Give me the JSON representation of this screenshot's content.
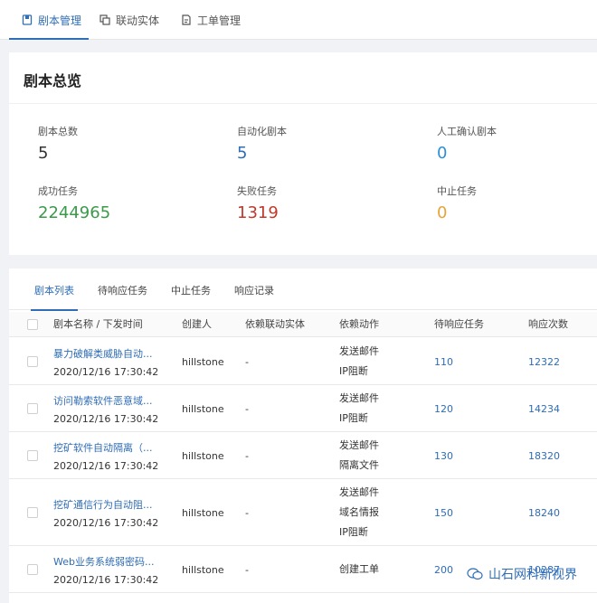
{
  "top_tabs": [
    {
      "label": "剧本管理",
      "icon": "playbook-icon"
    },
    {
      "label": "联动实体",
      "icon": "copy-icon"
    },
    {
      "label": "工单管理",
      "icon": "ticket-icon"
    }
  ],
  "overview": {
    "title": "剧本总览",
    "stats": [
      {
        "label": "剧本总数",
        "value": "5",
        "color": "#333333"
      },
      {
        "label": "自动化剧本",
        "value": "5",
        "color": "#2f6db5"
      },
      {
        "label": "人工确认剧本",
        "value": "0",
        "color": "#2f8fd6"
      },
      {
        "label": "成功任务",
        "value": "2244965",
        "color": "#3a9a4a"
      },
      {
        "label": "失败任务",
        "value": "1319",
        "color": "#c0392b"
      },
      {
        "label": "中止任务",
        "value": "0",
        "color": "#e8a33a"
      }
    ]
  },
  "sub_tabs": [
    "剧本列表",
    "待响应任务",
    "中止任务",
    "响应记录"
  ],
  "table": {
    "headers": [
      "剧本名称 / 下发时间",
      "创建人",
      "依赖联动实体",
      "依赖动作",
      "待响应任务",
      "响应次数"
    ],
    "rows": [
      {
        "name": "暴力破解类威胁自动...",
        "time": "2020/12/16 17:30:42",
        "creator": "hillstone",
        "entity": "-",
        "actions": [
          "发送邮件",
          "IP阻断"
        ],
        "pending": "110",
        "count": "12322"
      },
      {
        "name": "访问勒索软件恶意域...",
        "time": "2020/12/16 17:30:42",
        "creator": "hillstone",
        "entity": "-",
        "actions": [
          "发送邮件",
          "IP阻断"
        ],
        "pending": "120",
        "count": "14234"
      },
      {
        "name": "挖矿软件自动隔离（...",
        "time": "2020/12/16 17:30:42",
        "creator": "hillstone",
        "entity": "-",
        "actions": [
          "发送邮件",
          "隔离文件"
        ],
        "pending": "130",
        "count": "18320"
      },
      {
        "name": "挖矿通信行为自动阻...",
        "time": "2020/12/16 17:30:42",
        "creator": "hillstone",
        "entity": "-",
        "actions": [
          "发送邮件",
          "域名情报",
          "IP阻断"
        ],
        "pending": "150",
        "count": "18240"
      },
      {
        "name": "Web业务系统弱密码...",
        "time": "2020/12/16 17:30:42",
        "creator": "hillstone",
        "entity": "-",
        "actions": [
          "创建工单"
        ],
        "pending": "200",
        "count": "10287"
      }
    ]
  },
  "watermark": {
    "text": "山石网科新视界",
    "icon": "wechat-icon"
  }
}
